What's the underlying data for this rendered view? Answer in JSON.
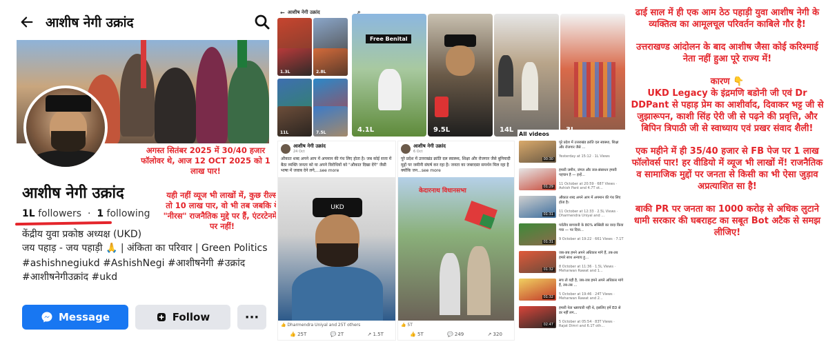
{
  "left": {
    "header_name": "आशीष नेगी उक्रांद",
    "cover_note": "अगस्त सितंबर 2025 में 30/40 हजार फॉलोवर थे, आज 12 OCT 2025 को 1 लाख पार!",
    "profile_name": "आशीष नेगी उक्रांद",
    "followers_count": "1L",
    "followers_label": "followers",
    "following_count": "1",
    "following_label": "following",
    "views_note": "यही नहीं व्यूज भी लाखों में, कुछ रील्स तो 10 लाख पार, वो भी तब जबकि ये \"नीरस\" राजनैतिक मुद्दे पर हैं, एंटरटेनमेंट पर नहीं!",
    "bio_line1": "केंद्रीय युवा प्रकोष्ठ अध्यक्ष (UKD)",
    "bio_line2": "जय पहाड़ - जय पहाड़ी 🙏 | अंकिता का परिवार | Green Politics",
    "bio_line3": "#ashishnegiukd #AshishNegi #आशीषनेगी #उक्रांद #आशीषनेगीउक्रांद #ukd",
    "btn_message": "Message",
    "btn_follow": "Follow",
    "btn_more": "···"
  },
  "mid": {
    "bar_name": "आशीष नेगी उक्रांद",
    "reel_small_counts": [
      "",
      "",
      "1.3L",
      "2.8L",
      "",
      "",
      "11L",
      "7.5L"
    ],
    "reels": [
      {
        "count": "4.1L",
        "tag": "Free Benital"
      },
      {
        "count": "9.5L",
        "tag": ""
      },
      {
        "count": "14L",
        "tag": ""
      },
      {
        "count": "3L",
        "tag": ""
      }
    ],
    "post1": {
      "name": "आशीष नेगी उक्रांद",
      "date": "24 Oct",
      "text": "औकात शब्द अपने आप में अपमान की गंध लिए होता है। जब कोई सत्ता में बैठा व्यक्ति जनता को या अपने विरोधियों को \"औकात दिखा देंगे\" जैसी भाषा में जवाब देने लगे,...see more",
      "img_label": "UKD",
      "reactions": "Dharmendra Uniyal and 25T others",
      "likes": "25T",
      "comments": "2T",
      "shares": "1.5T"
    },
    "post2": {
      "name": "आशीष नेगी उक्रांद",
      "date": "6 Oct",
      "text": "पूरे प्रदेश में उत्तराखंड क्रांति दल स्वास्थ्य, शिक्षा और रोजगार जैसे बुनियादी मुद्दों पर जमीनी संघर्ष कर रहा है। जनता का जबरदस्त समर्थन मिल रहा है क्योंकि जन...see more",
      "img_label": "केदारनाथ विधानसभा",
      "reactions": "5T",
      "likes": "5T",
      "comments": "249",
      "shares": "320"
    },
    "videos_title": "All videos",
    "videos": [
      {
        "dur": "00:30",
        "title": "पूरे प्रदेश में उत्तराखंड क्रांति दल स्वास्थ्य, शिक्षा और रोजगार जैसे ...",
        "meta": "Yesterday at 15:12 · 1L Views"
      },
      {
        "dur": "01:29",
        "title": "हमारी जमीन, जंगल और जल-संसाधन हमारी पहचान है — इन्हें...",
        "meta": "11 October at 20:59 · 687 Views · Ashish Pant and 4.7T ot..."
      },
      {
        "dur": "01:31",
        "title": "औकात शब्द अपने आप में अपमान की गंध लिए होता है।",
        "meta": "11 October at 12:33 · 2.5L Views · Dharmendra Uniyal and ..."
      },
      {
        "dur": "01:31",
        "title": "पर्वतीय बागवानी के 80% सब्सिडी का वादा किया गया — पर दिया...",
        "meta": "9 October at 19:22 · 661 Views · 7.1T"
      },
      {
        "dur": "01:32",
        "title": "जब-जब हमने अपने अधिकार मांगे हैं, तब-तब हमारे साथ अन्याय हु...",
        "meta": "8 October at 11:36 · 1.5L Views · Meharwan Rawat and 1..."
      },
      {
        "dur": "01:32",
        "title": "सच तो यही है, जब-जब हमने अपने अधिकार मांगे हैं, तब-तब ...",
        "meta": "5 October at 19:46 · 24T Views · Meharwan Rawat and 2..."
      },
      {
        "dur": "02:47",
        "title": "हमारी नेता भ्रष्टाचारी नहीं थे, इसलिए हमें ED से डर नहीं लग...",
        "meta": "5 October at 05:54 · 83T Views · Rajat Dimri and 6.1T oth..."
      }
    ]
  },
  "right": {
    "p1": "ढाई साल में ही एक आम ठेठ पहाड़ी युवा आशीष नेगी के व्यक्तित्व का आमूलचूल परिवर्तन काबिले गौर है!",
    "p2": "उत्तराखण्ड आंदोलन के बाद आशीष जैसा कोई करिश्माई नेता नहीं हुआ पूरे राज्य में!",
    "p3a": "कारण 👇",
    "p3b": "UKD Legacy के इंद्रमणि बडोनी जी एवं Dr DDPant से पहाड़ प्रेम का आशीर्वाद, दिवाकर भट्ट जी से जुझारूपन, काशी सिंह ऐरी जी से पढ़ने की प्रवृत्ति, और बिपिन त्रिपाठी जी से स्वाध्याय एवं प्रखर संवाद शैली!",
    "p4": "एक महीने में ही 35/40 हजार से FB पेज पर 1 लाख फॉलोवर्स पार! हर वीडियो में व्यूज भी लाखों में! राजनैतिक व सामाजिक मुद्दों पर जनता से किसी का भी ऐसा जुड़ाव अप्रत्याशित सा है!",
    "p5": "बाकी PR पर जनता का 1000 करोड़ से अधिक लुटाने धामी सरकार की घबराहट का सबूत Bot अटैक से समझ लीजिए!"
  },
  "colors": {
    "accent_red": "#e4252b",
    "fb_blue": "#1877f2",
    "button_gray": "#e4e6eb"
  }
}
